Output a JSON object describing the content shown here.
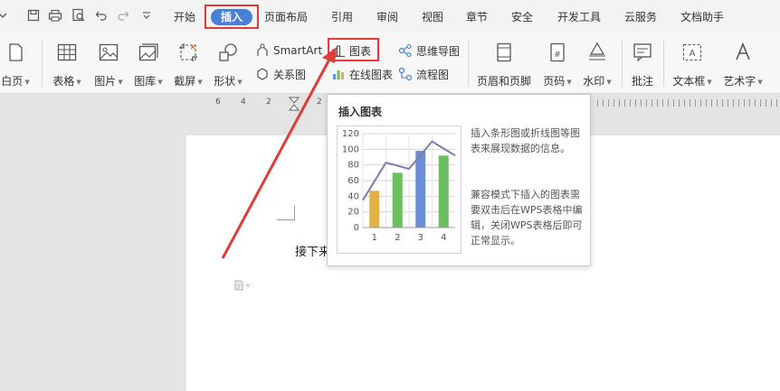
{
  "menubar": {
    "tabs": [
      "开始",
      "插入",
      "页面布局",
      "引用",
      "审阅",
      "视图",
      "章节",
      "安全",
      "开发工具",
      "云服务",
      "文档助手"
    ],
    "active_tab": "插入"
  },
  "ribbon": {
    "blank_page": "白页",
    "table": "表格",
    "picture": "图片",
    "gallery": "图库",
    "screenshot": "截屏",
    "shape": "形状",
    "smartart": "SmartArt",
    "relation": "关系图",
    "chart": "图表",
    "online_chart": "在线图表",
    "mindmap": "思维导图",
    "flowchart": "流程图",
    "header_footer": "页眉和页脚",
    "page_number": "页码",
    "watermark": "水印",
    "comment": "批注",
    "textbox": "文本框",
    "wordart": "艺术字"
  },
  "ruler": [
    "6",
    "4",
    "2",
    "2"
  ],
  "document": {
    "text": "接下来"
  },
  "tooltip": {
    "title": "插入图表",
    "desc1": "插入条形图或折线图等图表来展现数据的信息。",
    "desc2": "兼容模式下插入的图表需要双击后在WPS表格中编辑，关闭WPS表格后即可正常显示。"
  },
  "chart_data": {
    "type": "bar",
    "categories": [
      "1",
      "2",
      "3",
      "4"
    ],
    "values": [
      47,
      70,
      98,
      92
    ],
    "line_values": [
      35,
      83,
      75,
      110,
      92
    ],
    "yticks": [
      "0",
      "20",
      "40",
      "60",
      "80",
      "100",
      "120"
    ],
    "ylim": [
      0,
      120
    ],
    "bar_colors": [
      "#e0b24a",
      "#6cbf5e",
      "#6a8fd6",
      "#6cbf5e"
    ],
    "line_color": "#7a7fb0",
    "grid": true
  },
  "colors": {
    "highlight_red": "#e03c3c",
    "active_tab_bg": "#4a7fd6"
  }
}
